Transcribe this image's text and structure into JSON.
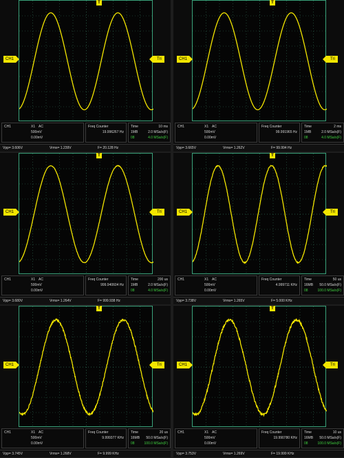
{
  "panels": [
    {
      "channel_label": "CH1",
      "trigger_label": "Tri",
      "trigger_top_label": "T",
      "probe": "X1",
      "coupling": "AC",
      "volts_div": "500mV",
      "offset": "0.00mV",
      "freq_counter_title": "Freq Counter",
      "freq_counter_value": "19.996267 Hz",
      "time_title": "Time",
      "time_div": "10 ms",
      "depth": "1MB",
      "sample_rate": "2.0 MSa/s(F)",
      "mode": "08",
      "live_rate": "4.0 MSa/s(F)",
      "vpp": "Vpp= 3.606V",
      "vrms": "Vrms= 1.239V",
      "freq": "F= 20.128 Hz",
      "wave": {
        "cycles": 2,
        "phase": 0.78,
        "amp": 0.4,
        "noise": 0.0
      }
    },
    {
      "channel_label": "CH1",
      "trigger_label": "Tri",
      "trigger_top_label": "T",
      "probe": "X1",
      "coupling": "AC",
      "volts_div": "500mV",
      "offset": "0.00mV",
      "freq_counter_title": "Freq Counter",
      "freq_counter_value": "99.991965 Hz",
      "time_title": "Time",
      "time_div": "2 ms",
      "depth": "1MB",
      "sample_rate": "2.0 MSa/s(F)",
      "mode": "08",
      "live_rate": "4.0 MSa/s(F)",
      "vpp": "Vpp= 3.665V",
      "vrms": "Vrms= 1.262V",
      "freq": "F= 99.994 Hz",
      "wave": {
        "cycles": 2,
        "phase": 0.78,
        "amp": 0.4,
        "noise": 0.0
      }
    },
    {
      "channel_label": "CH1",
      "trigger_label": "Tri",
      "trigger_top_label": "T",
      "probe": "X1",
      "coupling": "AC",
      "volts_div": "500mV",
      "offset": "0.00mV",
      "freq_counter_title": "Freq Counter",
      "freq_counter_value": "999.940604 Hz",
      "time_title": "Time",
      "time_div": "200 us",
      "depth": "1MB",
      "sample_rate": "2.0 MSa/s(F)",
      "mode": "08",
      "live_rate": "4.0 MSa/s(F)",
      "vpp": "Vpp= 3.680V",
      "vrms": "Vrms= 1.264V",
      "freq": "F= 999.938 Hz",
      "wave": {
        "cycles": 2,
        "phase": 0.78,
        "amp": 0.4,
        "noise": 0.002
      }
    },
    {
      "channel_label": "CH1",
      "trigger_label": "Tri",
      "trigger_top_label": "T",
      "probe": "X1",
      "coupling": "AC",
      "volts_div": "500mV",
      "offset": "0.00mV",
      "freq_counter_title": "Freq Counter",
      "freq_counter_value": "4.999711 KHz",
      "time_title": "Time",
      "time_div": "50 us",
      "depth": "16MB",
      "sample_rate": "50.0 MSa/s(F)",
      "mode": "08",
      "live_rate": "100.0 MSa/s(F)",
      "vpp": "Vpp= 3.738V",
      "vrms": "Vrms= 1.265V",
      "freq": "F= 5.000 KHz",
      "wave": {
        "cycles": 2.5,
        "phase": 0.78,
        "amp": 0.4,
        "noise": 0.004
      }
    },
    {
      "channel_label": "CH1",
      "trigger_label": "Tri",
      "trigger_top_label": "T",
      "probe": "X1",
      "coupling": "AC",
      "volts_div": "500mV",
      "offset": "0.00mV",
      "freq_counter_title": "Freq Counter",
      "freq_counter_value": "9.999377 KHz",
      "time_title": "Time",
      "time_div": "20 us",
      "depth": "16MB",
      "sample_rate": "50.0 MSa/s(F)",
      "mode": "08",
      "live_rate": "100.0 MSa/s(F)",
      "vpp": "Vpp= 3.745V",
      "vrms": "Vrms= 1.268V",
      "freq": "F= 9.999 KHz",
      "wave": {
        "cycles": 2,
        "phase": 0.7,
        "amp": 0.39,
        "noise": 0.008
      }
    },
    {
      "channel_label": "CH1",
      "trigger_label": "Tri",
      "trigger_top_label": "T",
      "probe": "X1",
      "coupling": "AC",
      "volts_div": "500mV",
      "offset": "0.00mV",
      "freq_counter_title": "Freq Counter",
      "freq_counter_value": "19.990780 KHz",
      "time_title": "Time",
      "time_div": "10 us",
      "depth": "16MB",
      "sample_rate": "50.0 MSa/s(F)",
      "mode": "08",
      "live_rate": "100.0 MSa/s(F)",
      "vpp": "Vpp= 3.753V",
      "vrms": "Vrms= 1.269V",
      "freq": "F= 19.999 KHz",
      "wave": {
        "cycles": 2,
        "phase": 0.7,
        "amp": 0.39,
        "noise": 0.01
      }
    }
  ],
  "colors": {
    "trace": "#f4e600",
    "grid": "#2f6b55",
    "border": "#3aa37b",
    "accent_green": "#40d040"
  }
}
